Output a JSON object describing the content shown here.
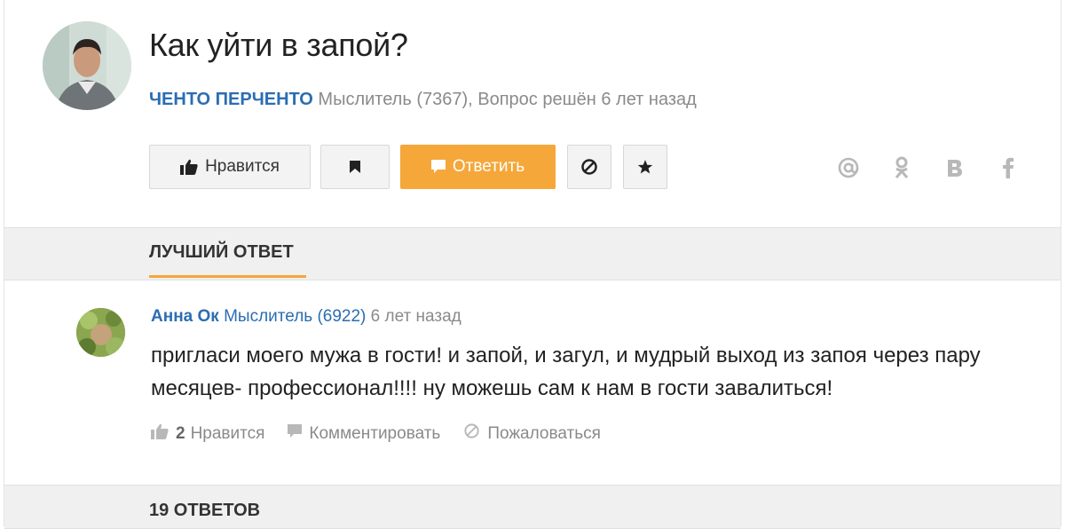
{
  "question": {
    "title": "Как уйти в запой?",
    "author": "ЧЕНТО ПЕРЧЕНТО",
    "rank": "Мыслитель (7367),",
    "status": "Вопрос решён 6 лет назад"
  },
  "actions": {
    "like_label": "Нравится",
    "answer_label": "Ответить",
    "accent_color": "#f5a73a",
    "link_color": "#2b6db3"
  },
  "share": {
    "items": [
      "@",
      "ok",
      "B",
      "f"
    ]
  },
  "best_answer": {
    "section_title": "ЛУЧШИЙ ОТВЕТ",
    "author": "Анна Ок",
    "rank": "Мыслитель (6922)",
    "time": "6 лет назад",
    "text": "пригласи моего мужа в гости! и запой, и загул, и мудрый выход из запоя через пару месяцев- профессионал!!!! ну можешь сам к нам в гости завалиться!",
    "likes_count": "2",
    "like_label": "Нравится",
    "comment_label": "Комментировать",
    "report_label": "Пожаловаться"
  },
  "answers_section": {
    "title": "19 ОТВЕТОВ"
  }
}
